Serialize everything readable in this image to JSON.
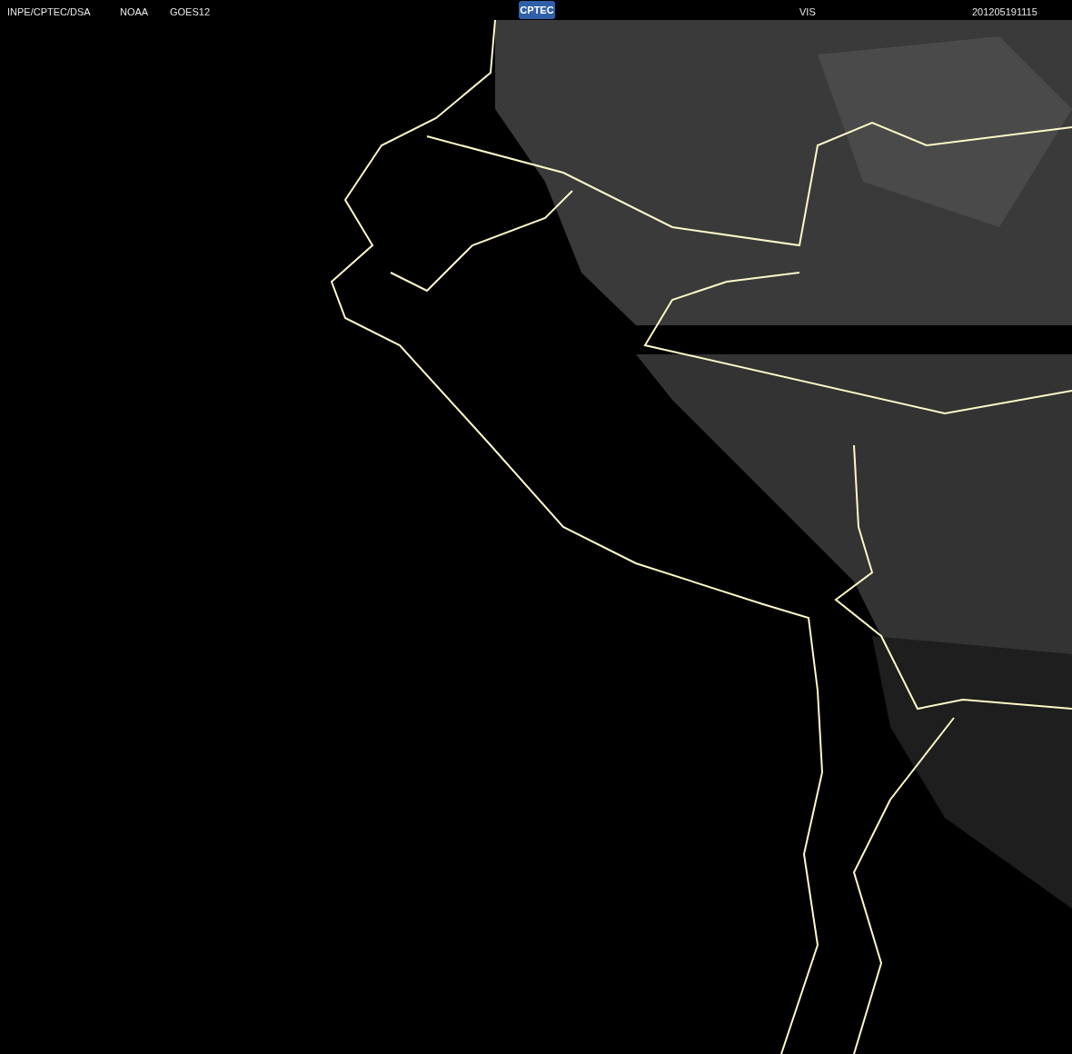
{
  "header": {
    "texts": [
      "INPE/CPTEC/DSA",
      "NOAA",
      "GOES12"
    ],
    "logo": "CPTEC",
    "channel": "VIS",
    "timestamp": "201205191115"
  }
}
